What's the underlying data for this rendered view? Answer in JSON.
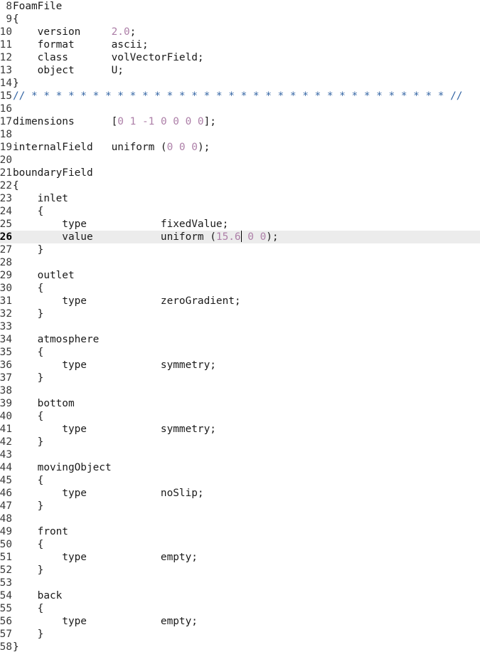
{
  "editor": {
    "current_line": "26",
    "lines": [
      {
        "n": "8",
        "segs": [
          {
            "t": "FoamFile"
          }
        ]
      },
      {
        "n": "9",
        "segs": [
          {
            "t": "{"
          }
        ]
      },
      {
        "n": "10",
        "segs": [
          {
            "t": "    version     "
          },
          {
            "t": "2.0",
            "c": "num"
          },
          {
            "t": ";"
          }
        ]
      },
      {
        "n": "11",
        "segs": [
          {
            "t": "    format      ascii;"
          }
        ]
      },
      {
        "n": "12",
        "segs": [
          {
            "t": "    class       volVectorField;"
          }
        ]
      },
      {
        "n": "13",
        "segs": [
          {
            "t": "    object      U;"
          }
        ]
      },
      {
        "n": "14",
        "segs": [
          {
            "t": "}"
          }
        ]
      },
      {
        "n": "15",
        "segs": [
          {
            "t": "// * * * * * * * * * * * * * * * * * * * * * * * * * * * * * * * * * * //",
            "c": "cmt"
          }
        ]
      },
      {
        "n": "16",
        "segs": []
      },
      {
        "n": "17",
        "segs": [
          {
            "t": "dimensions      ["
          },
          {
            "t": "0 1 -1 0 0 0 0",
            "c": "num"
          },
          {
            "t": "];"
          }
        ]
      },
      {
        "n": "18",
        "segs": []
      },
      {
        "n": "19",
        "segs": [
          {
            "t": "internalField   uniform ("
          },
          {
            "t": "0 0 0",
            "c": "num"
          },
          {
            "t": ");"
          }
        ]
      },
      {
        "n": "20",
        "segs": []
      },
      {
        "n": "21",
        "segs": [
          {
            "t": "boundaryField"
          }
        ]
      },
      {
        "n": "22",
        "segs": [
          {
            "t": "{"
          }
        ]
      },
      {
        "n": "23",
        "segs": [
          {
            "t": "    inlet"
          }
        ]
      },
      {
        "n": "24",
        "segs": [
          {
            "t": "    {"
          }
        ]
      },
      {
        "n": "25",
        "segs": [
          {
            "t": "        type            fixedValue;"
          }
        ]
      },
      {
        "n": "26",
        "segs": [
          {
            "t": "        value           uniform ("
          },
          {
            "t": "15.6",
            "c": "num"
          },
          {
            "cursor": true
          },
          {
            "t": " "
          },
          {
            "t": "0 0",
            "c": "num"
          },
          {
            "t": ");"
          }
        ]
      },
      {
        "n": "27",
        "segs": [
          {
            "t": "    }"
          }
        ]
      },
      {
        "n": "28",
        "segs": []
      },
      {
        "n": "29",
        "segs": [
          {
            "t": "    outlet"
          }
        ]
      },
      {
        "n": "30",
        "segs": [
          {
            "t": "    {"
          }
        ]
      },
      {
        "n": "31",
        "segs": [
          {
            "t": "        type            zeroGradient;"
          }
        ]
      },
      {
        "n": "32",
        "segs": [
          {
            "t": "    }"
          }
        ]
      },
      {
        "n": "33",
        "segs": []
      },
      {
        "n": "34",
        "segs": [
          {
            "t": "    atmosphere"
          }
        ]
      },
      {
        "n": "35",
        "segs": [
          {
            "t": "    {"
          }
        ]
      },
      {
        "n": "36",
        "segs": [
          {
            "t": "        type            symmetry;"
          }
        ]
      },
      {
        "n": "37",
        "segs": [
          {
            "t": "    }"
          }
        ]
      },
      {
        "n": "38",
        "segs": []
      },
      {
        "n": "39",
        "segs": [
          {
            "t": "    bottom"
          }
        ]
      },
      {
        "n": "40",
        "segs": [
          {
            "t": "    {"
          }
        ]
      },
      {
        "n": "41",
        "segs": [
          {
            "t": "        type            symmetry;"
          }
        ]
      },
      {
        "n": "42",
        "segs": [
          {
            "t": "    }"
          }
        ]
      },
      {
        "n": "43",
        "segs": []
      },
      {
        "n": "44",
        "segs": [
          {
            "t": "    movingObject"
          }
        ]
      },
      {
        "n": "45",
        "segs": [
          {
            "t": "    {"
          }
        ]
      },
      {
        "n": "46",
        "segs": [
          {
            "t": "        type            noSlip;"
          }
        ]
      },
      {
        "n": "47",
        "segs": [
          {
            "t": "    }"
          }
        ]
      },
      {
        "n": "48",
        "segs": []
      },
      {
        "n": "49",
        "segs": [
          {
            "t": "    front"
          }
        ]
      },
      {
        "n": "50",
        "segs": [
          {
            "t": "    {"
          }
        ]
      },
      {
        "n": "51",
        "segs": [
          {
            "t": "        type            empty;"
          }
        ]
      },
      {
        "n": "52",
        "segs": [
          {
            "t": "    }"
          }
        ]
      },
      {
        "n": "53",
        "segs": []
      },
      {
        "n": "54",
        "segs": [
          {
            "t": "    back"
          }
        ]
      },
      {
        "n": "55",
        "segs": [
          {
            "t": "    {"
          }
        ]
      },
      {
        "n": "56",
        "segs": [
          {
            "t": "        type            empty;"
          }
        ]
      },
      {
        "n": "57",
        "segs": [
          {
            "t": "    }"
          }
        ]
      },
      {
        "n": "58",
        "segs": [
          {
            "t": "}"
          }
        ]
      }
    ]
  }
}
